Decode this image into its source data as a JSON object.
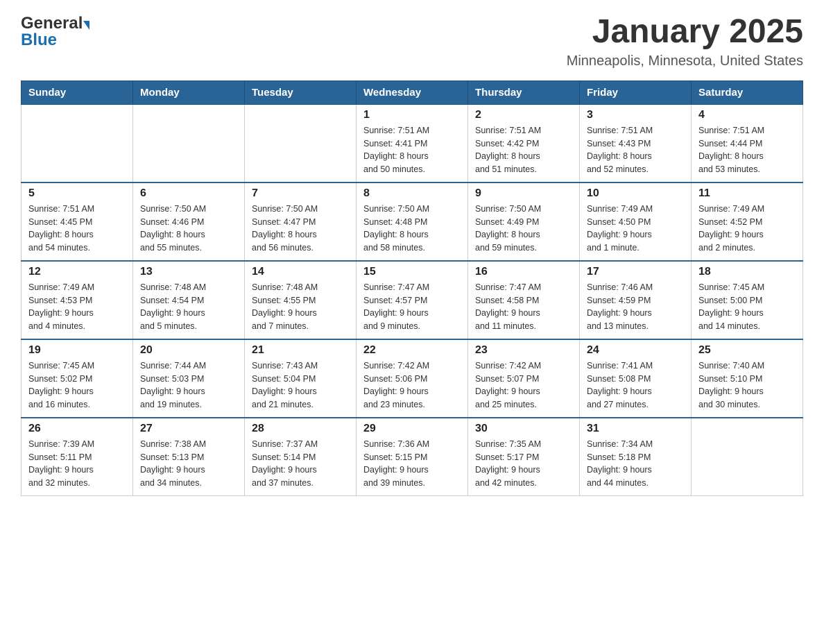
{
  "header": {
    "logo_general": "General",
    "logo_blue": "Blue",
    "month_title": "January 2025",
    "location": "Minneapolis, Minnesota, United States"
  },
  "weekdays": [
    "Sunday",
    "Monday",
    "Tuesday",
    "Wednesday",
    "Thursday",
    "Friday",
    "Saturday"
  ],
  "weeks": [
    [
      {
        "day": "",
        "info": ""
      },
      {
        "day": "",
        "info": ""
      },
      {
        "day": "",
        "info": ""
      },
      {
        "day": "1",
        "info": "Sunrise: 7:51 AM\nSunset: 4:41 PM\nDaylight: 8 hours\nand 50 minutes."
      },
      {
        "day": "2",
        "info": "Sunrise: 7:51 AM\nSunset: 4:42 PM\nDaylight: 8 hours\nand 51 minutes."
      },
      {
        "day": "3",
        "info": "Sunrise: 7:51 AM\nSunset: 4:43 PM\nDaylight: 8 hours\nand 52 minutes."
      },
      {
        "day": "4",
        "info": "Sunrise: 7:51 AM\nSunset: 4:44 PM\nDaylight: 8 hours\nand 53 minutes."
      }
    ],
    [
      {
        "day": "5",
        "info": "Sunrise: 7:51 AM\nSunset: 4:45 PM\nDaylight: 8 hours\nand 54 minutes."
      },
      {
        "day": "6",
        "info": "Sunrise: 7:50 AM\nSunset: 4:46 PM\nDaylight: 8 hours\nand 55 minutes."
      },
      {
        "day": "7",
        "info": "Sunrise: 7:50 AM\nSunset: 4:47 PM\nDaylight: 8 hours\nand 56 minutes."
      },
      {
        "day": "8",
        "info": "Sunrise: 7:50 AM\nSunset: 4:48 PM\nDaylight: 8 hours\nand 58 minutes."
      },
      {
        "day": "9",
        "info": "Sunrise: 7:50 AM\nSunset: 4:49 PM\nDaylight: 8 hours\nand 59 minutes."
      },
      {
        "day": "10",
        "info": "Sunrise: 7:49 AM\nSunset: 4:50 PM\nDaylight: 9 hours\nand 1 minute."
      },
      {
        "day": "11",
        "info": "Sunrise: 7:49 AM\nSunset: 4:52 PM\nDaylight: 9 hours\nand 2 minutes."
      }
    ],
    [
      {
        "day": "12",
        "info": "Sunrise: 7:49 AM\nSunset: 4:53 PM\nDaylight: 9 hours\nand 4 minutes."
      },
      {
        "day": "13",
        "info": "Sunrise: 7:48 AM\nSunset: 4:54 PM\nDaylight: 9 hours\nand 5 minutes."
      },
      {
        "day": "14",
        "info": "Sunrise: 7:48 AM\nSunset: 4:55 PM\nDaylight: 9 hours\nand 7 minutes."
      },
      {
        "day": "15",
        "info": "Sunrise: 7:47 AM\nSunset: 4:57 PM\nDaylight: 9 hours\nand 9 minutes."
      },
      {
        "day": "16",
        "info": "Sunrise: 7:47 AM\nSunset: 4:58 PM\nDaylight: 9 hours\nand 11 minutes."
      },
      {
        "day": "17",
        "info": "Sunrise: 7:46 AM\nSunset: 4:59 PM\nDaylight: 9 hours\nand 13 minutes."
      },
      {
        "day": "18",
        "info": "Sunrise: 7:45 AM\nSunset: 5:00 PM\nDaylight: 9 hours\nand 14 minutes."
      }
    ],
    [
      {
        "day": "19",
        "info": "Sunrise: 7:45 AM\nSunset: 5:02 PM\nDaylight: 9 hours\nand 16 minutes."
      },
      {
        "day": "20",
        "info": "Sunrise: 7:44 AM\nSunset: 5:03 PM\nDaylight: 9 hours\nand 19 minutes."
      },
      {
        "day": "21",
        "info": "Sunrise: 7:43 AM\nSunset: 5:04 PM\nDaylight: 9 hours\nand 21 minutes."
      },
      {
        "day": "22",
        "info": "Sunrise: 7:42 AM\nSunset: 5:06 PM\nDaylight: 9 hours\nand 23 minutes."
      },
      {
        "day": "23",
        "info": "Sunrise: 7:42 AM\nSunset: 5:07 PM\nDaylight: 9 hours\nand 25 minutes."
      },
      {
        "day": "24",
        "info": "Sunrise: 7:41 AM\nSunset: 5:08 PM\nDaylight: 9 hours\nand 27 minutes."
      },
      {
        "day": "25",
        "info": "Sunrise: 7:40 AM\nSunset: 5:10 PM\nDaylight: 9 hours\nand 30 minutes."
      }
    ],
    [
      {
        "day": "26",
        "info": "Sunrise: 7:39 AM\nSunset: 5:11 PM\nDaylight: 9 hours\nand 32 minutes."
      },
      {
        "day": "27",
        "info": "Sunrise: 7:38 AM\nSunset: 5:13 PM\nDaylight: 9 hours\nand 34 minutes."
      },
      {
        "day": "28",
        "info": "Sunrise: 7:37 AM\nSunset: 5:14 PM\nDaylight: 9 hours\nand 37 minutes."
      },
      {
        "day": "29",
        "info": "Sunrise: 7:36 AM\nSunset: 5:15 PM\nDaylight: 9 hours\nand 39 minutes."
      },
      {
        "day": "30",
        "info": "Sunrise: 7:35 AM\nSunset: 5:17 PM\nDaylight: 9 hours\nand 42 minutes."
      },
      {
        "day": "31",
        "info": "Sunrise: 7:34 AM\nSunset: 5:18 PM\nDaylight: 9 hours\nand 44 minutes."
      },
      {
        "day": "",
        "info": ""
      }
    ]
  ]
}
